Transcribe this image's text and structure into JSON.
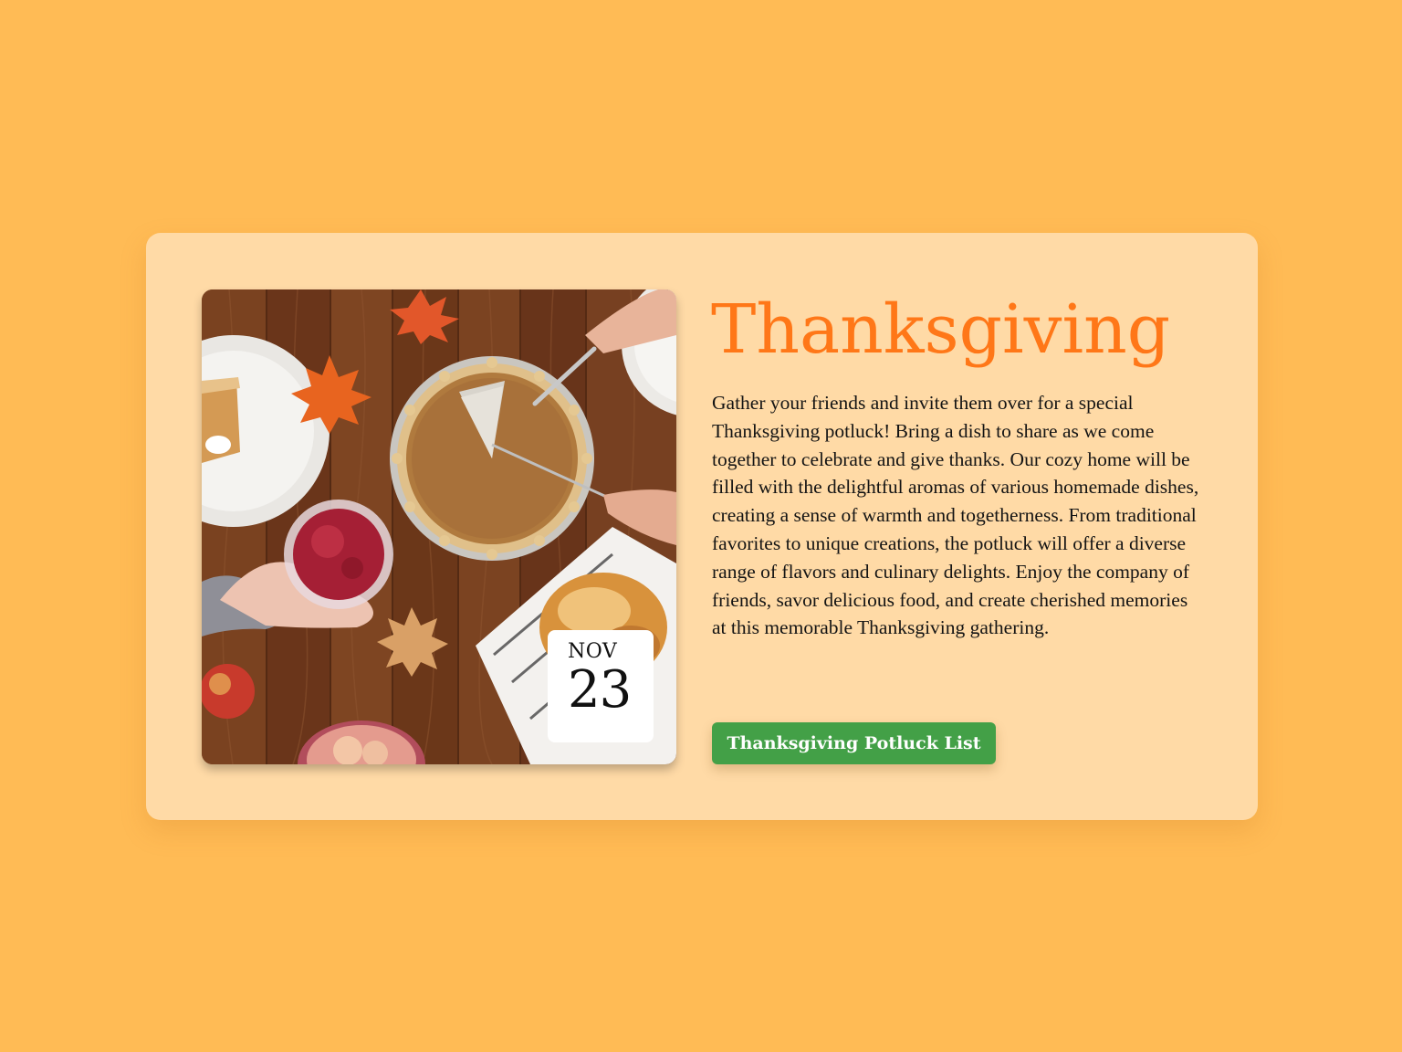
{
  "event": {
    "title": "Thanksgiving",
    "description": "Gather your friends and invite them over for a special Thanksgiving potluck! Bring a dish to share as we come together to celebrate and give thanks. Our cozy home will be filled with the delightful aromas of various homemade dishes, creating a sense of warmth and togetherness. From traditional favorites to unique creations, the potluck will offer a diverse range of flavors and culinary delights. Enjoy the company of friends, savor delicious food, and create cherished memories at this memorable Thanksgiving gathering.",
    "date": {
      "month": "NOV",
      "day": "23"
    },
    "cta_label": "Thanksgiving Potluck List",
    "image_subject": "pumpkin-pie-table-photo"
  },
  "colors": {
    "page_background": "#ffbb55",
    "card_background": "#ffdaa6",
    "title": "#ff7718",
    "button": "#43a047",
    "button_text": "#ffffff"
  }
}
